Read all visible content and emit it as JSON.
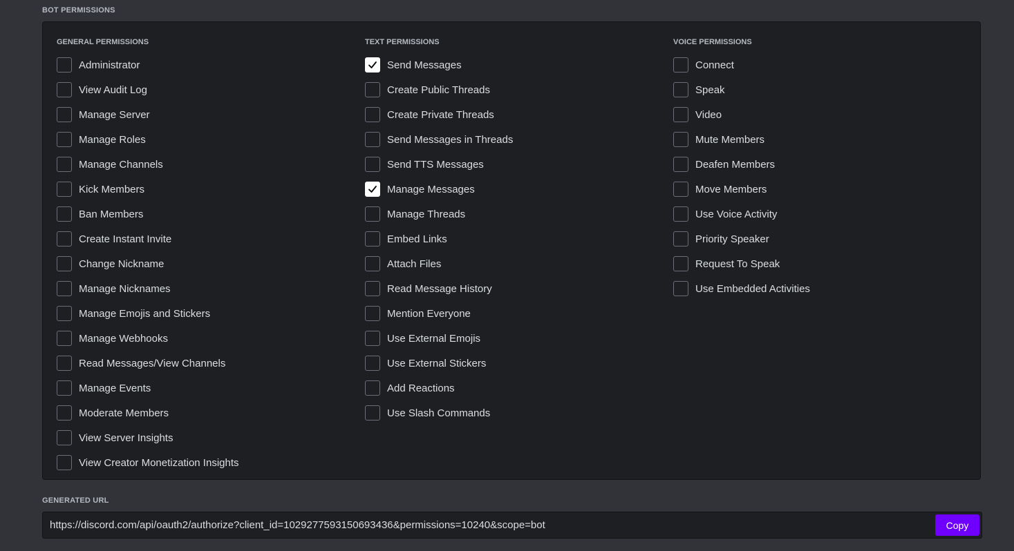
{
  "bot_permissions": {
    "title": "BOT PERMISSIONS",
    "columns": [
      {
        "title": "GENERAL PERMISSIONS",
        "items": [
          {
            "label": "Administrator",
            "checked": false
          },
          {
            "label": "View Audit Log",
            "checked": false
          },
          {
            "label": "Manage Server",
            "checked": false
          },
          {
            "label": "Manage Roles",
            "checked": false
          },
          {
            "label": "Manage Channels",
            "checked": false
          },
          {
            "label": "Kick Members",
            "checked": false
          },
          {
            "label": "Ban Members",
            "checked": false
          },
          {
            "label": "Create Instant Invite",
            "checked": false
          },
          {
            "label": "Change Nickname",
            "checked": false
          },
          {
            "label": "Manage Nicknames",
            "checked": false
          },
          {
            "label": "Manage Emojis and Stickers",
            "checked": false
          },
          {
            "label": "Manage Webhooks",
            "checked": false
          },
          {
            "label": "Read Messages/View Channels",
            "checked": false
          },
          {
            "label": "Manage Events",
            "checked": false
          },
          {
            "label": "Moderate Members",
            "checked": false
          },
          {
            "label": "View Server Insights",
            "checked": false
          },
          {
            "label": "View Creator Monetization Insights",
            "checked": false
          }
        ]
      },
      {
        "title": "TEXT PERMISSIONS",
        "items": [
          {
            "label": "Send Messages",
            "checked": true
          },
          {
            "label": "Create Public Threads",
            "checked": false
          },
          {
            "label": "Create Private Threads",
            "checked": false
          },
          {
            "label": "Send Messages in Threads",
            "checked": false
          },
          {
            "label": "Send TTS Messages",
            "checked": false
          },
          {
            "label": "Manage Messages",
            "checked": true
          },
          {
            "label": "Manage Threads",
            "checked": false
          },
          {
            "label": "Embed Links",
            "checked": false
          },
          {
            "label": "Attach Files",
            "checked": false
          },
          {
            "label": "Read Message History",
            "checked": false
          },
          {
            "label": "Mention Everyone",
            "checked": false
          },
          {
            "label": "Use External Emojis",
            "checked": false
          },
          {
            "label": "Use External Stickers",
            "checked": false
          },
          {
            "label": "Add Reactions",
            "checked": false
          },
          {
            "label": "Use Slash Commands",
            "checked": false
          }
        ]
      },
      {
        "title": "VOICE PERMISSIONS",
        "items": [
          {
            "label": "Connect",
            "checked": false
          },
          {
            "label": "Speak",
            "checked": false
          },
          {
            "label": "Video",
            "checked": false
          },
          {
            "label": "Mute Members",
            "checked": false
          },
          {
            "label": "Deafen Members",
            "checked": false
          },
          {
            "label": "Move Members",
            "checked": false
          },
          {
            "label": "Use Voice Activity",
            "checked": false
          },
          {
            "label": "Priority Speaker",
            "checked": false
          },
          {
            "label": "Request To Speak",
            "checked": false
          },
          {
            "label": "Use Embedded Activities",
            "checked": false
          }
        ]
      }
    ]
  },
  "generated_url": {
    "title": "GENERATED URL",
    "value": "https://discord.com/api/oauth2/authorize?client_id=1029277593150693436&permissions=10240&scope=bot",
    "copy_label": "Copy"
  },
  "colors": {
    "copy_button": "#6f00ff"
  }
}
